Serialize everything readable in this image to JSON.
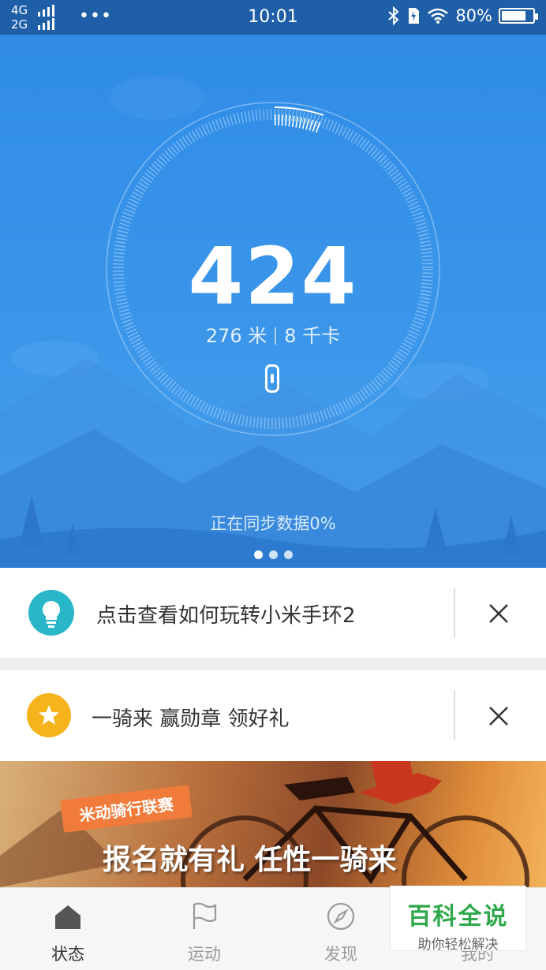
{
  "status_bar": {
    "network_top": "4G",
    "network_bottom": "2G",
    "more": "•••",
    "time": "10:01",
    "battery_percent": "80%",
    "battery_level": 0.8
  },
  "dashboard": {
    "steps": "424",
    "distance": "276 米",
    "calories": "8 千卡",
    "sync_status": "正在同步数据0%",
    "page_count": 3,
    "active_page": 0
  },
  "cards": [
    {
      "text": "点击查看如何玩转小米手环2",
      "icon": "lightbulb-icon",
      "color": "#29b6c8"
    },
    {
      "text": "一骑来 赢勋章 领好礼",
      "icon": "star-icon",
      "color": "#f6b31b"
    }
  ],
  "banner": {
    "ribbon": "米动骑行联赛",
    "title": "报名就有礼  任性一骑来"
  },
  "tabs": [
    {
      "label": "状态",
      "icon": "home-icon",
      "active": true
    },
    {
      "label": "运动",
      "icon": "flag-icon",
      "active": false
    },
    {
      "label": "发现",
      "icon": "compass-icon",
      "active": false
    },
    {
      "label": "我的",
      "icon": "person-icon",
      "active": false
    }
  ],
  "watermark": {
    "title": "百科全说",
    "subtitle": "助你轻松解决"
  },
  "colors": {
    "status_bar": "#1f5fa8",
    "hero_blue": "#2f8ce6",
    "accent_teal": "#29b6c8",
    "accent_yellow": "#f6b31b",
    "watermark_green": "#2ea84a"
  }
}
